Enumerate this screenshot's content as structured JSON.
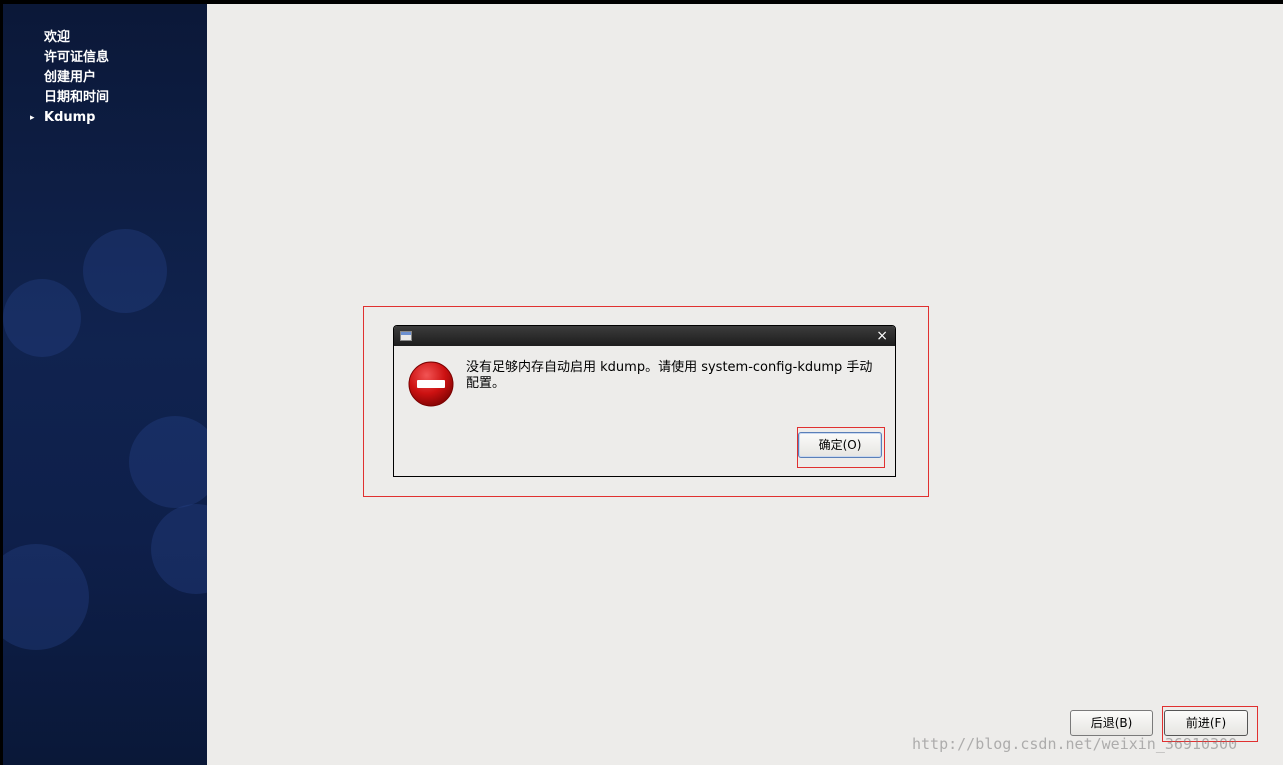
{
  "sidebar": {
    "steps": [
      {
        "label": "欢迎"
      },
      {
        "label": "许可证信息"
      },
      {
        "label": "创建用户"
      },
      {
        "label": "日期和时间"
      },
      {
        "label": "Kdump",
        "current": true
      }
    ],
    "current_marker": "▸"
  },
  "dialog": {
    "close_glyph": "×",
    "icon": "error-stop-icon",
    "message_line1": "没有足够内存自动启用 kdump。请使用 system-config-kdump 手动",
    "message_line2": "配置。",
    "ok_label": "确定(O)"
  },
  "navigation": {
    "back_label": "后退(B)",
    "forward_label": "前进(F)"
  },
  "watermark": "http://blog.csdn.net/weixin_36910300",
  "colors": {
    "sidebar_bg": "#10234f",
    "content_bg": "#edecea",
    "annotation_border": "#e03030",
    "error_red": "#cc1111"
  }
}
